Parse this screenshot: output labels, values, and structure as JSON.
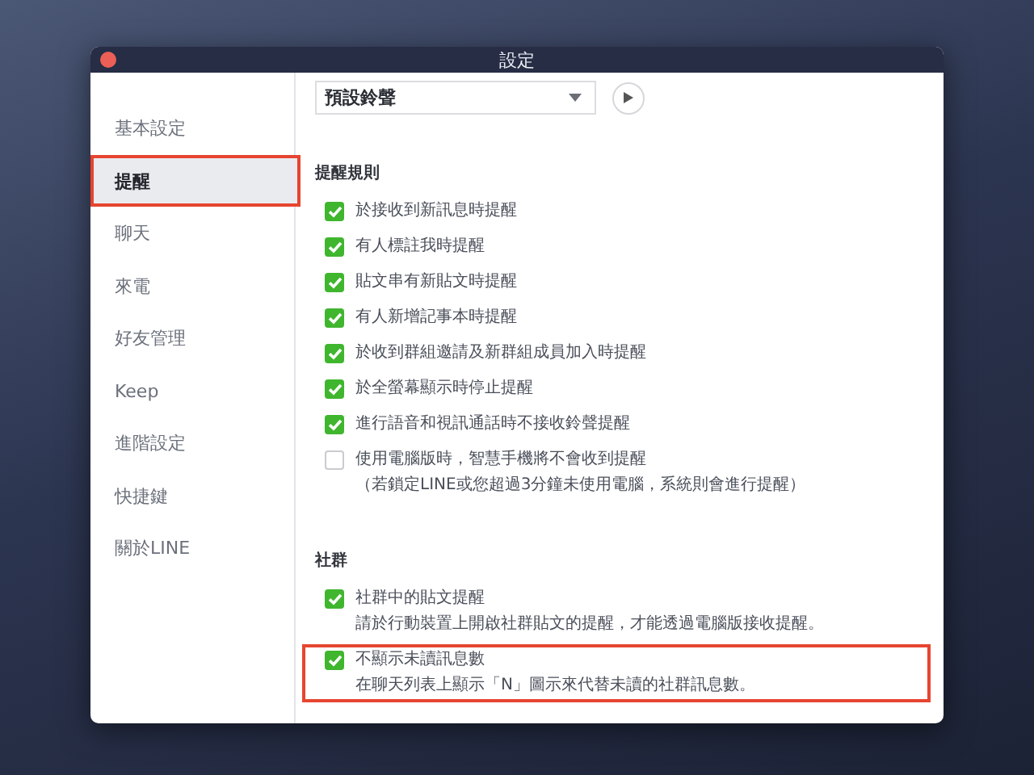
{
  "window": {
    "title": "設定"
  },
  "sidebar": {
    "items": [
      {
        "label": "基本設定",
        "selected": false,
        "highlighted": false
      },
      {
        "label": "提醒",
        "selected": true,
        "highlighted": true
      },
      {
        "label": "聊天",
        "selected": false,
        "highlighted": false
      },
      {
        "label": "來電",
        "selected": false,
        "highlighted": false
      },
      {
        "label": "好友管理",
        "selected": false,
        "highlighted": false
      },
      {
        "label": "Keep",
        "selected": false,
        "highlighted": false
      },
      {
        "label": "進階設定",
        "selected": false,
        "highlighted": false
      },
      {
        "label": "快捷鍵",
        "selected": false,
        "highlighted": false
      },
      {
        "label": "關於LINE",
        "selected": false,
        "highlighted": false
      }
    ]
  },
  "ringtone": {
    "value": "預設鈴聲"
  },
  "sections": [
    {
      "heading": "提醒規則",
      "items": [
        {
          "label": "於接收到新訊息時提醒",
          "checked": true,
          "highlighted": false
        },
        {
          "label": "有人標註我時提醒",
          "checked": true,
          "highlighted": false
        },
        {
          "label": "貼文串有新貼文時提醒",
          "checked": true,
          "highlighted": false
        },
        {
          "label": "有人新增記事本時提醒",
          "checked": true,
          "highlighted": false
        },
        {
          "label": "於收到群組邀請及新群組成員加入時提醒",
          "checked": true,
          "highlighted": false
        },
        {
          "label": "於全螢幕顯示時停止提醒",
          "checked": true,
          "highlighted": false
        },
        {
          "label": "進行語音和視訊通話時不接收鈴聲提醒",
          "checked": true,
          "highlighted": false
        },
        {
          "label": "使用電腦版時，智慧手機將不會收到提醒",
          "note": "（若鎖定LINE或您超過3分鐘未使用電腦，系統則會進行提醒）",
          "checked": false,
          "highlighted": false
        }
      ]
    },
    {
      "heading": "社群",
      "items": [
        {
          "label": "社群中的貼文提醒",
          "note": "請於行動裝置上開啟社群貼文的提醒，才能透過電腦版接收提醒。",
          "checked": true,
          "highlighted": false
        },
        {
          "label": "不顯示未讀訊息數",
          "note": "在聊天列表上顯示「N」圖示來代替未讀的社群訊息數。",
          "checked": true,
          "highlighted": true
        }
      ]
    }
  ]
}
